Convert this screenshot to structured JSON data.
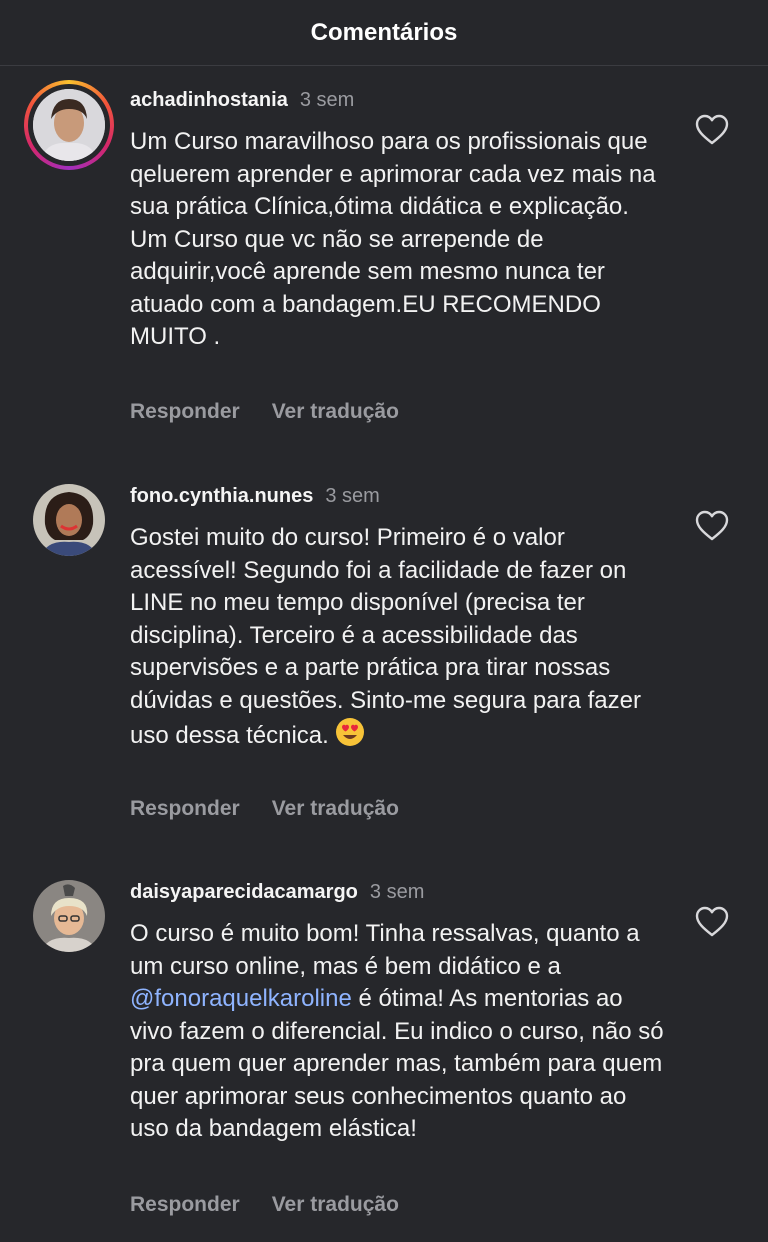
{
  "header": {
    "title": "Comentários"
  },
  "comments": [
    {
      "username": "achadinhostania",
      "time": "3 sem",
      "text": "Um Curso maravilhoso para os profissionais que qeluerem aprender e aprimorar cada vez mais na sua prática Clínica,ótima didática e explicação. Um Curso que vc não se arrepende de adquirir,você aprende sem mesmo nunca ter atuado com a bandagem.EU RECOMENDO MUITO .",
      "reply_label": "Responder",
      "translate_label": "Ver tradução",
      "has_story_ring": true
    },
    {
      "username": "fono.cynthia.nunes",
      "time": "3 sem",
      "text": "Gostei muito do curso! Primeiro é o valor acessível! Segundo foi a facilidade de fazer on LINE no meu tempo disponível (precisa ter disciplina). Terceiro é a acessibilidade das supervisões e a parte prática pra tirar nossas dúvidas e questões. Sinto-me segura para fazer uso dessa técnica.",
      "emoji": "heart-eyes-emoji",
      "reply_label": "Responder",
      "translate_label": "Ver tradução",
      "has_story_ring": false
    },
    {
      "username": "daisyaparecidacamargo",
      "time": "3 sem",
      "text_before_mention": "O curso é muito bom! Tinha ressalvas, quanto a um curso online, mas é bem didático e a ",
      "mention": "@fonoraquelkaroline",
      "text_after_mention": " é ótima! As mentorias ao vivo fazem o diferencial. Eu indico o curso, não só pra quem quer aprender mas, também para quem quer aprimorar seus conhecimentos quanto ao uso da bandagem elástica!",
      "reply_label": "Responder",
      "translate_label": "Ver tradução",
      "has_story_ring": false
    }
  ],
  "icons": {
    "like": "heart-outline-icon"
  },
  "colors": {
    "background": "#26272b",
    "text": "#f2f2f2",
    "muted": "#9a9ba0",
    "mention": "#8fb4ff"
  }
}
